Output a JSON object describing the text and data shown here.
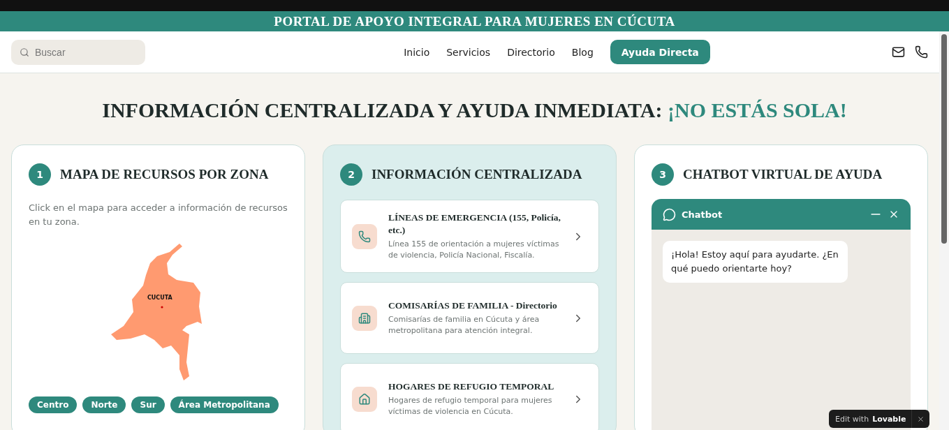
{
  "banner": {
    "title": "PORTAL DE APOYO INTEGRAL PARA MUJERES EN CÚCUTA"
  },
  "nav": {
    "search": {
      "placeholder": "Buscar"
    },
    "links": [
      {
        "label": "Inicio"
      },
      {
        "label": "Servicios"
      },
      {
        "label": "Directorio"
      },
      {
        "label": "Blog"
      }
    ],
    "cta": "Ayuda Directa"
  },
  "headline": {
    "text": "INFORMACIÓN CENTRALIZADA Y AYUDA INMEDIATA:",
    "accent": "¡NO ESTÁS SOLA!"
  },
  "sections": [
    {
      "kind": "map",
      "number": "1",
      "title": "MAPA DE RECURSOS POR ZONA",
      "description": "Click en el mapa para acceder a información de recursos en tu zona.",
      "map_label": "CUCUTA",
      "zones": [
        "Centro",
        "Norte",
        "Sur",
        "Área Metropolitana"
      ]
    },
    {
      "kind": "info",
      "number": "2",
      "title": "INFORMACIÓN CENTRALIZADA",
      "items": [
        {
          "title": "LÍNEAS DE EMERGENCIA (155, Policía, etc.)",
          "text": "Línea 155 de orientación a mujeres víctimas de violencia, Policía Nacional, Fiscalía."
        },
        {
          "title": "COMISARÍAS DE FAMILIA - Directorio",
          "text": "Comisarías de familia en Cúcuta y área metropolitana para atención integral."
        },
        {
          "title": "HOGARES DE REFUGIO TEMPORAL",
          "text": "Hogares de refugio temporal para mujeres víctimas de violencia en Cúcuta."
        }
      ]
    },
    {
      "kind": "chat",
      "number": "3",
      "title": "CHATBOT VIRTUAL DE AYUDA",
      "chat_title": "Chatbot",
      "messages": [
        "¡Hola! Estoy aquí para ayudarte. ¿En qué puedo orientarte hoy?"
      ]
    }
  ],
  "badge": {
    "prefix": "Edit with",
    "brand": "Lovable"
  }
}
